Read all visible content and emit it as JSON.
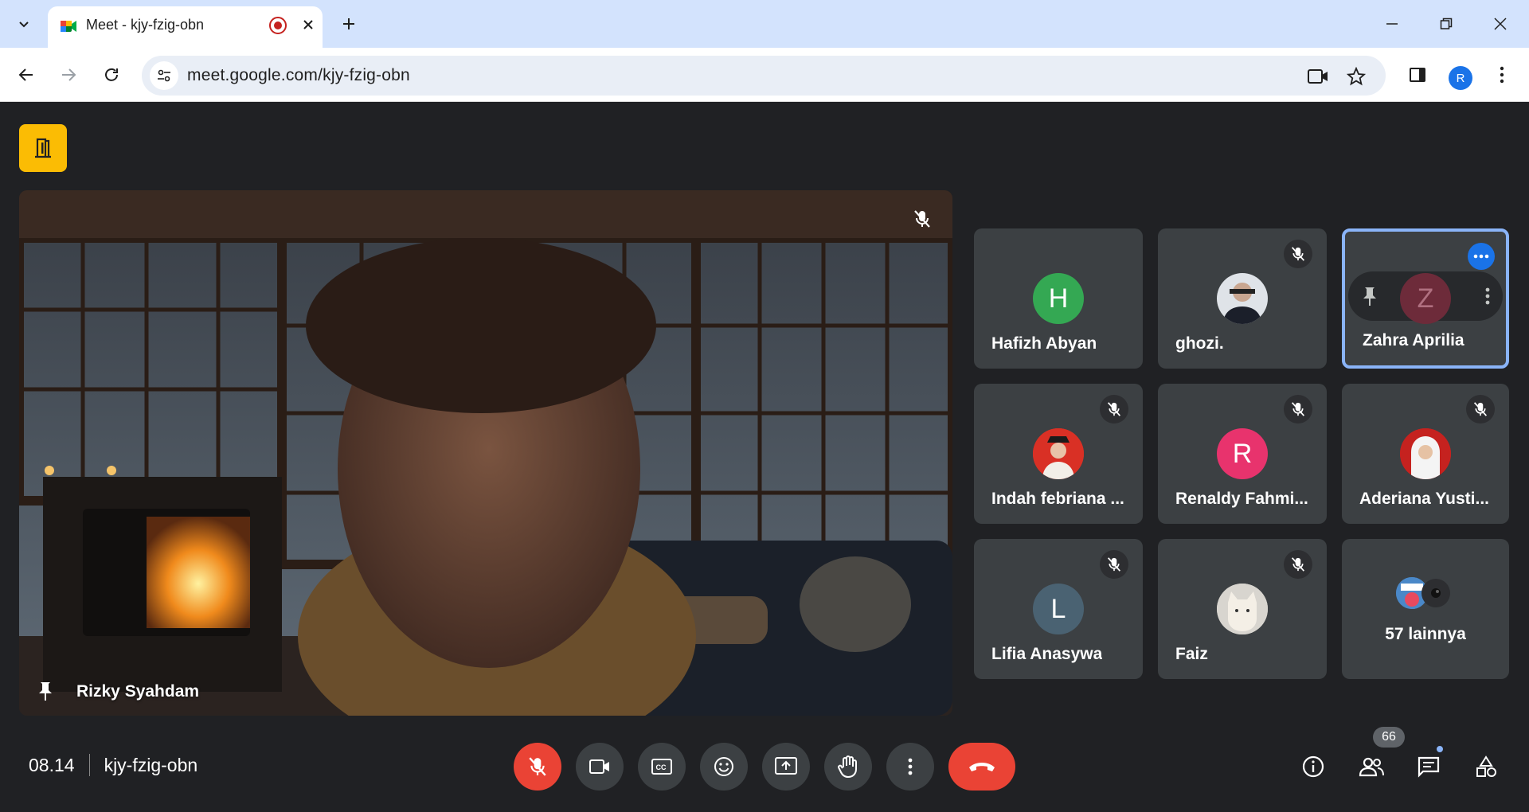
{
  "browser": {
    "tab_title": "Meet - kjy-fzig-obn",
    "url": "meet.google.com/kjy-fzig-obn",
    "profile_initial": "R"
  },
  "meeting": {
    "time": "08.14",
    "code": "kjy-fzig-obn",
    "main_speaker": "Rizky Syahdam",
    "participant_count": "66"
  },
  "participants": [
    {
      "name": "Hafizh Abyan",
      "initial": "H",
      "color": "#34a853",
      "muted": false
    },
    {
      "name": "ghozi.",
      "initial": "",
      "color": "#dfe3e8",
      "muted": true
    },
    {
      "name": "Zahra Aprilia",
      "initial": "Z",
      "color": "#6d2b3a",
      "muted": false
    },
    {
      "name": "Indah febriana ...",
      "initial": "",
      "color": "#d93025",
      "muted": true
    },
    {
      "name": "Renaldy Fahmi...",
      "initial": "R",
      "color": "#e8336d",
      "muted": true
    },
    {
      "name": "Aderiana Yusti...",
      "initial": "",
      "color": "#c5221f",
      "muted": true
    },
    {
      "name": "Lifia Anasywa",
      "initial": "L",
      "color": "#4a6272",
      "muted": true
    },
    {
      "name": "Faiz",
      "initial": "",
      "color": "#d8d5cf",
      "muted": true
    },
    {
      "name": "57 lainnya",
      "initial": "",
      "color": "#3c4043",
      "muted": false
    }
  ]
}
